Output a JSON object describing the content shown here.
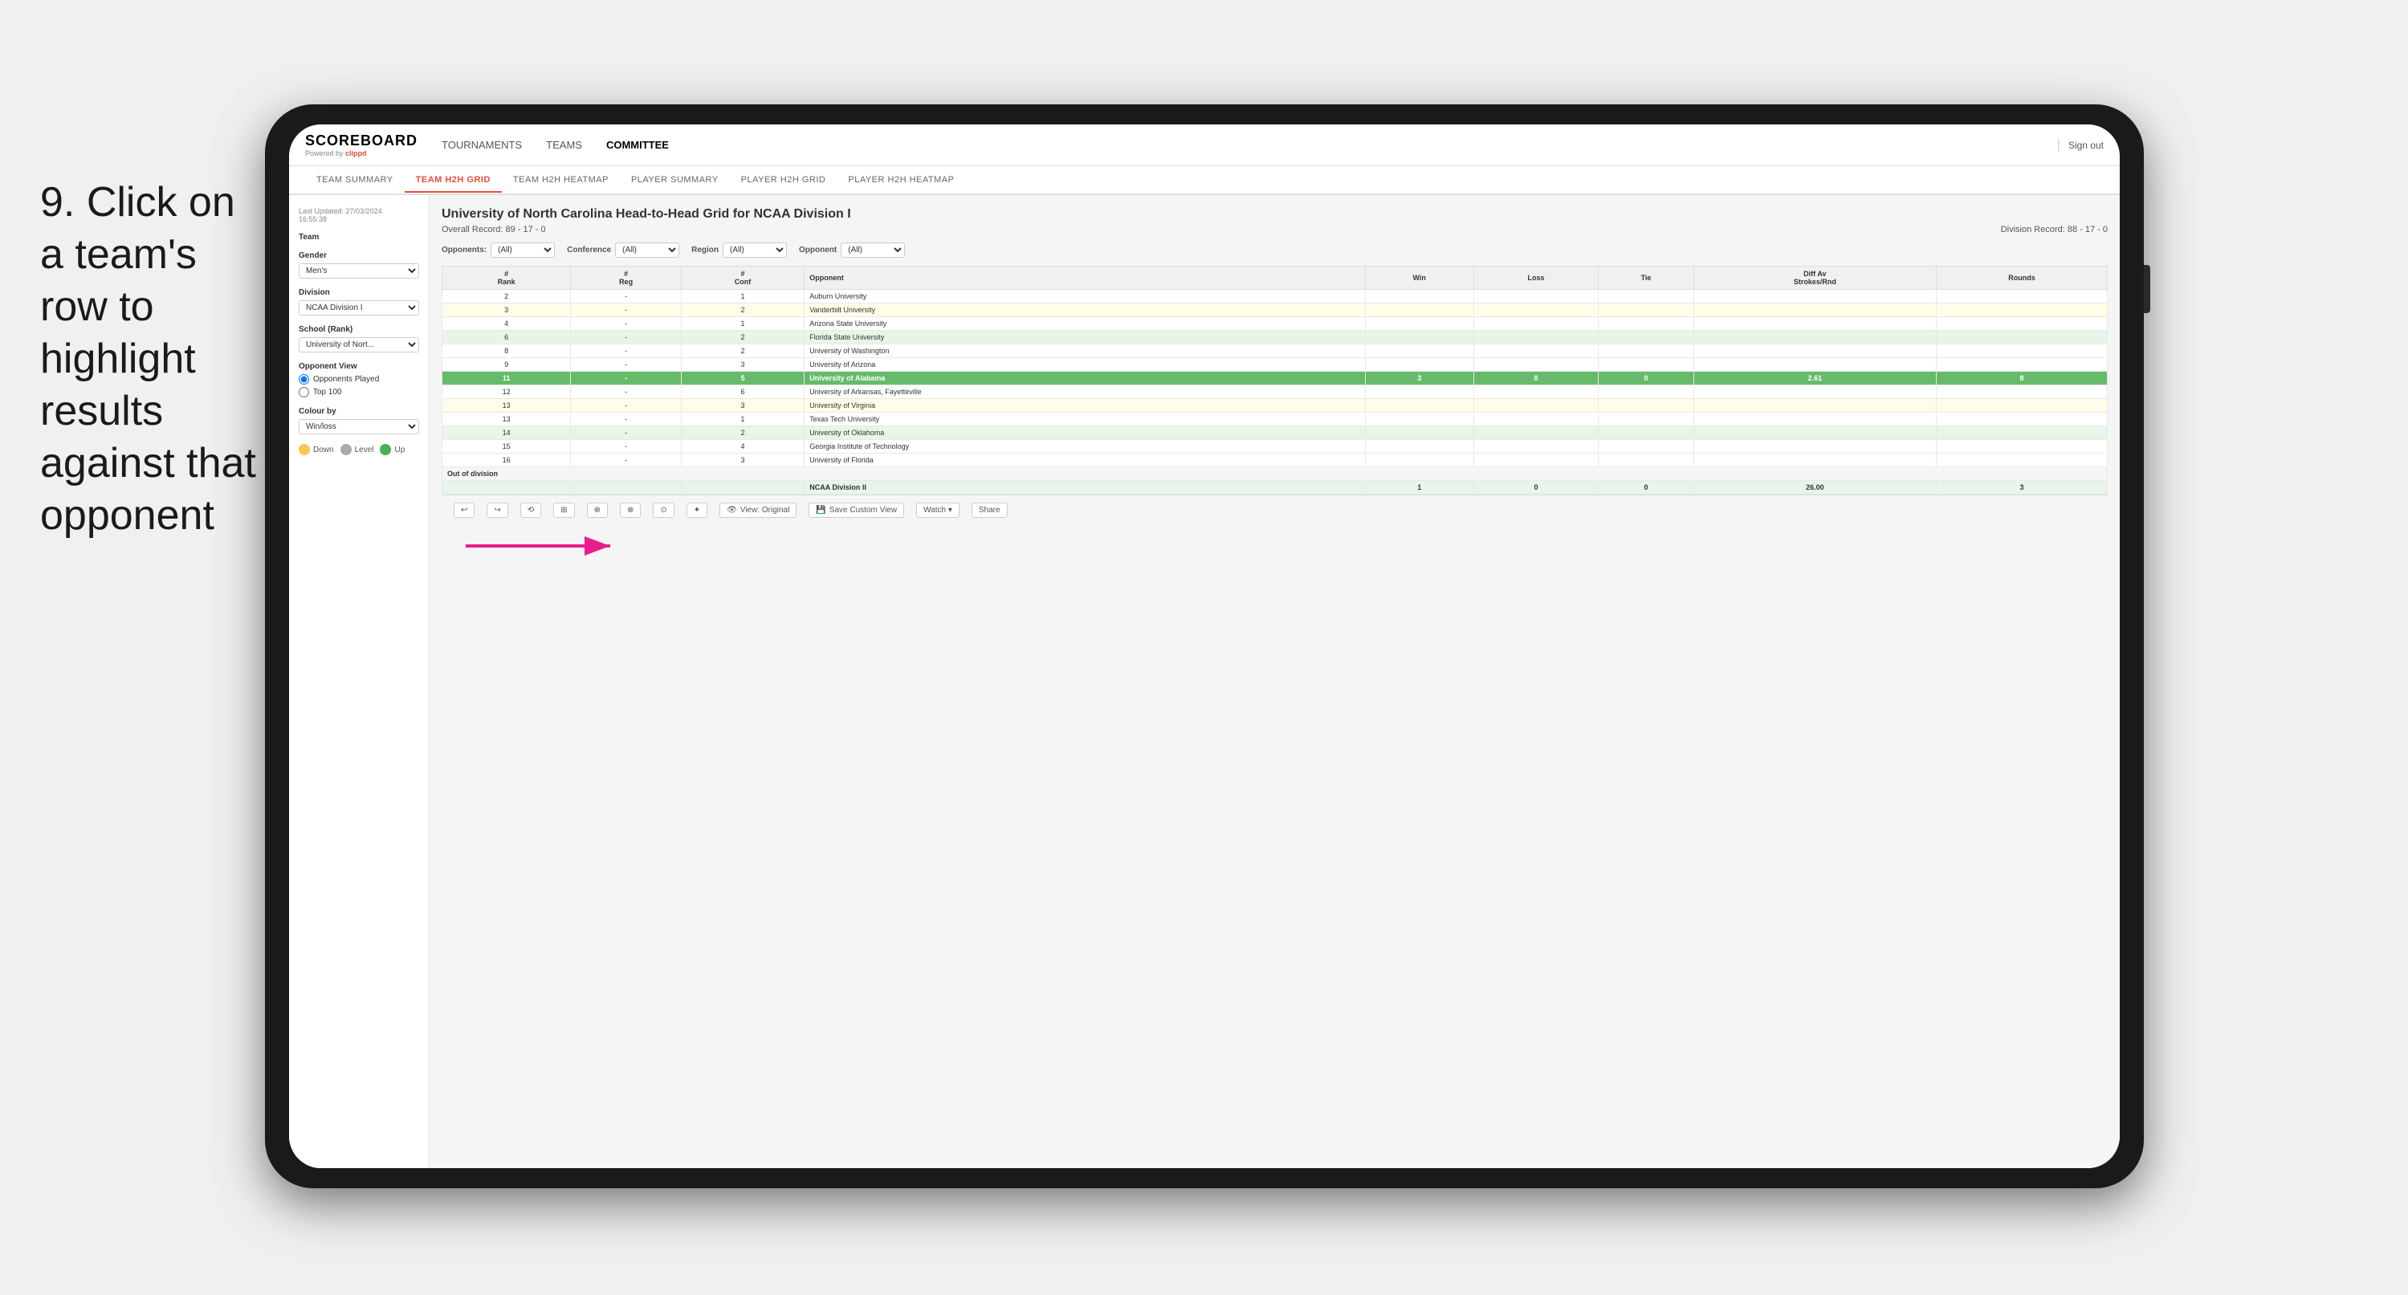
{
  "instruction": {
    "number": "9.",
    "text": "Click on a team's row to highlight results against that opponent"
  },
  "app": {
    "logo": "SCOREBOARD",
    "powered_by": "Powered by",
    "brand": "clippd",
    "nav": {
      "items": [
        {
          "label": "TOURNAMENTS",
          "active": false
        },
        {
          "label": "TEAMS",
          "active": false
        },
        {
          "label": "COMMITTEE",
          "active": true
        }
      ],
      "sign_out": "Sign out"
    },
    "sub_nav": [
      {
        "label": "TEAM SUMMARY",
        "active": false
      },
      {
        "label": "TEAM H2H GRID",
        "active": true
      },
      {
        "label": "TEAM H2H HEATMAP",
        "active": false
      },
      {
        "label": "PLAYER SUMMARY",
        "active": false
      },
      {
        "label": "PLAYER H2H GRID",
        "active": false
      },
      {
        "label": "PLAYER H2H HEATMAP",
        "active": false
      }
    ]
  },
  "sidebar": {
    "last_updated_label": "Last Updated: 27/03/2024",
    "last_updated_time": "16:55:38",
    "team_label": "Team",
    "gender_label": "Gender",
    "gender_value": "Men's",
    "division_label": "Division",
    "division_value": "NCAA Division I",
    "school_label": "School (Rank)",
    "school_value": "University of Nort...",
    "opponent_view_label": "Opponent View",
    "opponents_played": "Opponents Played",
    "top_100": "Top 100",
    "colour_by_label": "Colour by",
    "colour_by_value": "Win/loss",
    "legend": [
      {
        "label": "Down",
        "color": "#f9c74f"
      },
      {
        "label": "Level",
        "color": "#aaaaaa"
      },
      {
        "label": "Up",
        "color": "#4caf50"
      }
    ]
  },
  "grid": {
    "title": "University of North Carolina Head-to-Head Grid for NCAA Division I",
    "overall_record_label": "Overall Record:",
    "overall_record": "89 - 17 - 0",
    "division_record_label": "Division Record:",
    "division_record": "88 - 17 - 0",
    "filters": {
      "opponents_label": "Opponents:",
      "opponents_value": "(All)",
      "conference_label": "Conference",
      "conference_value": "(All)",
      "region_label": "Region",
      "region_value": "(All)",
      "opponent_label": "Opponent",
      "opponent_value": "(All)"
    },
    "columns": [
      {
        "label": "#\nRank"
      },
      {
        "label": "#\nReg"
      },
      {
        "label": "#\nConf"
      },
      {
        "label": "Opponent"
      },
      {
        "label": "Win"
      },
      {
        "label": "Loss"
      },
      {
        "label": "Tie"
      },
      {
        "label": "Diff Av\nStrokes/Rnd"
      },
      {
        "label": "Rounds"
      }
    ],
    "rows": [
      {
        "rank": "2",
        "reg": "-",
        "conf": "1",
        "opponent": "Auburn University",
        "win": "",
        "loss": "",
        "tie": "",
        "diff": "",
        "rounds": "",
        "style": "normal"
      },
      {
        "rank": "3",
        "reg": "-",
        "conf": "2",
        "opponent": "Vanderbilt University",
        "win": "",
        "loss": "",
        "tie": "",
        "diff": "",
        "rounds": "",
        "style": "light-yellow"
      },
      {
        "rank": "4",
        "reg": "-",
        "conf": "1",
        "opponent": "Arizona State University",
        "win": "",
        "loss": "",
        "tie": "",
        "diff": "",
        "rounds": "",
        "style": "normal"
      },
      {
        "rank": "6",
        "reg": "-",
        "conf": "2",
        "opponent": "Florida State University",
        "win": "",
        "loss": "",
        "tie": "",
        "diff": "",
        "rounds": "",
        "style": "light-green"
      },
      {
        "rank": "8",
        "reg": "-",
        "conf": "2",
        "opponent": "University of Washington",
        "win": "",
        "loss": "",
        "tie": "",
        "diff": "",
        "rounds": "",
        "style": "normal"
      },
      {
        "rank": "9",
        "reg": "-",
        "conf": "3",
        "opponent": "University of Arizona",
        "win": "",
        "loss": "",
        "tie": "",
        "diff": "",
        "rounds": "",
        "style": "normal"
      },
      {
        "rank": "11",
        "reg": "-",
        "conf": "5",
        "opponent": "University of Alabama",
        "win": "3",
        "loss": "0",
        "tie": "0",
        "diff": "2.61",
        "rounds": "8",
        "style": "highlighted"
      },
      {
        "rank": "12",
        "reg": "-",
        "conf": "6",
        "opponent": "University of Arkansas, Fayetteville",
        "win": "",
        "loss": "",
        "tie": "",
        "diff": "",
        "rounds": "",
        "style": "normal"
      },
      {
        "rank": "13",
        "reg": "-",
        "conf": "3",
        "opponent": "University of Virginia",
        "win": "",
        "loss": "",
        "tie": "",
        "diff": "",
        "rounds": "",
        "style": "light-yellow"
      },
      {
        "rank": "13",
        "reg": "-",
        "conf": "1",
        "opponent": "Texas Tech University",
        "win": "",
        "loss": "",
        "tie": "",
        "diff": "",
        "rounds": "",
        "style": "normal"
      },
      {
        "rank": "14",
        "reg": "-",
        "conf": "2",
        "opponent": "University of Oklahoma",
        "win": "",
        "loss": "",
        "tie": "",
        "diff": "",
        "rounds": "",
        "style": "light-green"
      },
      {
        "rank": "15",
        "reg": "-",
        "conf": "4",
        "opponent": "Georgia Institute of Technology",
        "win": "",
        "loss": "",
        "tie": "",
        "diff": "",
        "rounds": "",
        "style": "normal"
      },
      {
        "rank": "16",
        "reg": "-",
        "conf": "3",
        "opponent": "University of Florida",
        "win": "",
        "loss": "",
        "tie": "",
        "diff": "",
        "rounds": "",
        "style": "normal"
      }
    ],
    "out_of_division_label": "Out of division",
    "out_of_division_row": {
      "division": "NCAA Division II",
      "win": "1",
      "loss": "0",
      "tie": "0",
      "diff": "26.00",
      "rounds": "3"
    }
  },
  "toolbar": {
    "buttons": [
      {
        "label": "↩",
        "type": "icon"
      },
      {
        "label": "↪",
        "type": "icon"
      },
      {
        "label": "↩↩",
        "type": "icon"
      },
      {
        "label": "⊞",
        "type": "icon"
      },
      {
        "label": "⊕",
        "type": "icon"
      },
      {
        "label": "⊗",
        "type": "icon"
      },
      {
        "label": "⊙",
        "type": "icon"
      },
      {
        "label": "⊛",
        "type": "icon"
      }
    ],
    "view_label": "View: Original",
    "save_custom_label": "Save Custom View",
    "watch_label": "Watch ▾",
    "share_label": "Share"
  }
}
